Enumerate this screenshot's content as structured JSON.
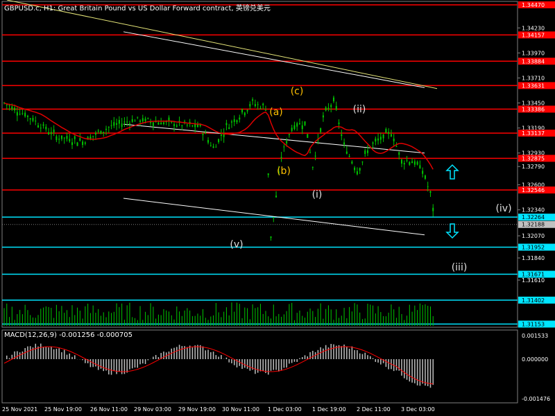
{
  "header": {
    "symbol": "GBPUSD.c, H1:",
    "description": "Great Britain Pound vs US Dollar Forward contract, 英镑兑美元"
  },
  "macd": {
    "label": "MACD(12,26,9) -0.001256 -0.000705",
    "axis_labels": [
      "0.001533",
      "0.000000",
      "-0.001476"
    ]
  },
  "colors": {
    "background": "#000000",
    "candle": "#00c800",
    "level_red": "#ff0000",
    "level_cyan": "#00e5ff",
    "ma_line": "#e00000",
    "channel": "#ffffff",
    "trend_yellow": "#e8e87a",
    "wave_yellow": "#ffc000",
    "wave_white": "#e0e0e0",
    "macd_hist": "#c0c0c0",
    "macd_signal": "#ff0000",
    "arrow": "#00e5ff"
  },
  "chart_data": {
    "type": "candlestick",
    "symbol": "GBPUSD.c",
    "timeframe": "H1",
    "price_range": [
      1.3112,
      1.3452
    ],
    "x_labels": [
      "25 Nov 2021",
      "25 Nov 19:00",
      "26 Nov 11:00",
      "29 Nov 03:00",
      "29 Nov 19:00",
      "30 Nov 11:00",
      "1 Dec 03:00",
      "1 Dec 19:00",
      "2 Dec 11:00",
      "3 Dec 03:00"
    ],
    "y_ticks": [
      "1.34470",
      "1.34157",
      "1.33884",
      "1.33631",
      "1.33386",
      "1.33137",
      "1.32875",
      "1.32546",
      "1.32264",
      "1.32188",
      "1.31952",
      "1.31671",
      "1.31402",
      "1.31153"
    ],
    "y_grid_labels": [
      "1.34230",
      "1.33970",
      "1.33710",
      "1.33450",
      "1.33190",
      "1.32930",
      "1.32790",
      "1.32600",
      "1.32340",
      "1.32070",
      "1.31840",
      "1.31610"
    ],
    "red_levels": [
      1.3447,
      1.34157,
      1.33884,
      1.33631,
      1.33386,
      1.33137,
      1.32875,
      1.32546
    ],
    "cyan_levels": [
      1.32264,
      1.31952,
      1.31671,
      1.31402,
      1.31153
    ],
    "current_price": 1.32188,
    "wave_labels": [
      {
        "text": "(a)",
        "color": "yellow"
      },
      {
        "text": "(b)",
        "color": "yellow"
      },
      {
        "text": "(c)",
        "color": "yellow"
      },
      {
        "text": "(i)",
        "color": "white"
      },
      {
        "text": "(ii)",
        "color": "white"
      },
      {
        "text": "(iii)",
        "color": "white"
      },
      {
        "text": "(iv)",
        "color": "white"
      },
      {
        "text": "(v)",
        "color": "white"
      }
    ],
    "arrows": [
      {
        "direction": "up"
      },
      {
        "direction": "down"
      }
    ],
    "indicators": [
      "MA",
      "MACD(12,26,9)",
      "Volume"
    ]
  }
}
